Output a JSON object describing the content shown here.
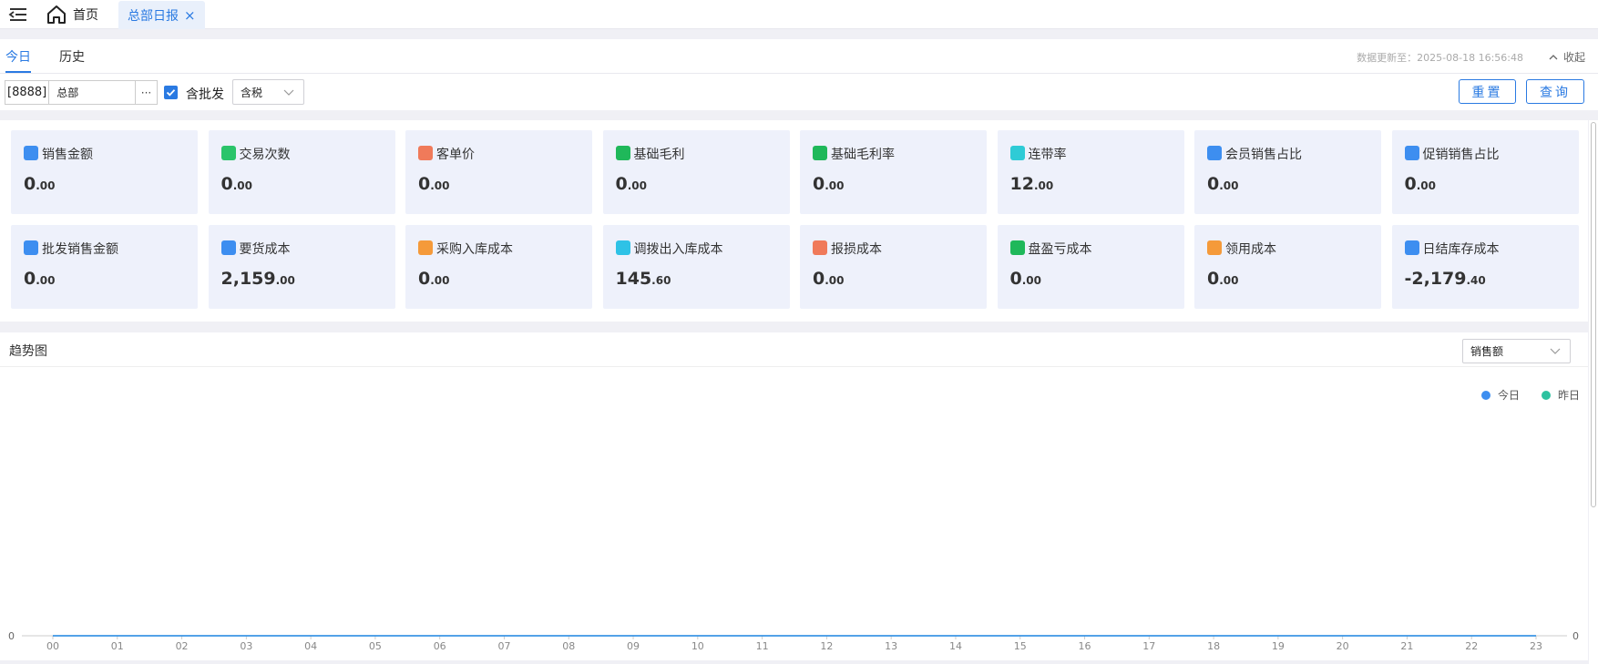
{
  "topbar": {
    "home_label": "首页",
    "active_tab_label": "总部日报",
    "close_glyph": "×"
  },
  "filter": {
    "tabs": [
      "今日",
      "历史"
    ],
    "active_tab": "今日",
    "updated_text": "数据更新至：2025-08-18 16:56:48",
    "collapse_label": "收起",
    "org_code": "[8888]",
    "org_name": "总部",
    "org_more": "···",
    "include_wholesale_label": "含批发",
    "include_wholesale_checked": true,
    "tax_value": "含税",
    "reset_label": "重置",
    "query_label": "查询"
  },
  "cards": [
    {
      "label": "销售金额",
      "int": "0",
      "dec": ".00",
      "icon": "wallet-icon",
      "color": "#3d8ef0"
    },
    {
      "label": "交易次数",
      "int": "0",
      "dec": ".00",
      "icon": "refresh-icon",
      "color": "#2bc46a"
    },
    {
      "label": "客单价",
      "int": "0",
      "dec": ".00",
      "icon": "tag-icon",
      "color": "#f07a5a"
    },
    {
      "label": "基础毛利",
      "int": "0",
      "dec": ".00",
      "icon": "diamond-icon",
      "color": "#1fb85a"
    },
    {
      "label": "基础毛利率",
      "int": "0",
      "dec": ".00",
      "icon": "percent-badge-icon",
      "color": "#1fb85a"
    },
    {
      "label": "连带率",
      "int": "12",
      "dec": ".00",
      "icon": "percent-icon",
      "color": "#2ecbd6"
    },
    {
      "label": "会员销售占比",
      "int": "0",
      "dec": ".00",
      "icon": "crown-icon",
      "color": "#3d8ef0"
    },
    {
      "label": "促销销售占比",
      "int": "0",
      "dec": ".00",
      "icon": "price-tag-icon",
      "color": "#3d8ef0"
    },
    {
      "label": "批发销售金额",
      "int": "0",
      "dec": ".00",
      "icon": "wholesale-icon",
      "color": "#3d8ef0"
    },
    {
      "label": "要货成本",
      "int": "2,159",
      "dec": ".00",
      "icon": "yuan-icon",
      "color": "#3d8ef0"
    },
    {
      "label": "采购入库成本",
      "int": "0",
      "dec": ".00",
      "icon": "cart-icon",
      "color": "#f59a3a"
    },
    {
      "label": "调拨出入库成本",
      "int": "145",
      "dec": ".60",
      "icon": "transfer-icon",
      "color": "#2ec2e6"
    },
    {
      "label": "报损成本",
      "int": "0",
      "dec": ".00",
      "icon": "loss-icon",
      "color": "#f07a5a"
    },
    {
      "label": "盘盈亏成本",
      "int": "0",
      "dec": ".00",
      "icon": "trend-icon",
      "color": "#1fb85a"
    },
    {
      "label": "领用成本",
      "int": "0",
      "dec": ".00",
      "icon": "list-icon",
      "color": "#f59a3a"
    },
    {
      "label": "日结库存成本",
      "int": "-2,179",
      "dec": ".40",
      "icon": "yuan-icon",
      "color": "#3d8ef0"
    }
  ],
  "trend": {
    "title": "趋势图",
    "metric_value": "销售额"
  },
  "chart_data": {
    "type": "line",
    "categories": [
      "00",
      "01",
      "02",
      "03",
      "04",
      "05",
      "06",
      "07",
      "08",
      "09",
      "10",
      "11",
      "12",
      "13",
      "14",
      "15",
      "16",
      "17",
      "18",
      "19",
      "20",
      "21",
      "22",
      "23"
    ],
    "series": [
      {
        "name": "今日",
        "color": "#3d8ef0",
        "values": [
          0,
          0,
          0,
          0,
          0,
          0,
          0,
          0,
          0,
          0,
          0,
          0,
          0,
          0,
          0,
          0,
          0,
          0,
          0,
          0,
          0,
          0,
          0,
          0
        ]
      },
      {
        "name": "昨日",
        "color": "#2ec2a0",
        "values": [
          0,
          0,
          0,
          0,
          0,
          0,
          0,
          0,
          0,
          0,
          0,
          0,
          0,
          0,
          0,
          0,
          0,
          0,
          0,
          0,
          0,
          0,
          0,
          0
        ]
      }
    ],
    "y_left_label": "0",
    "y_right_label": "0",
    "legend_position": "top-right"
  }
}
